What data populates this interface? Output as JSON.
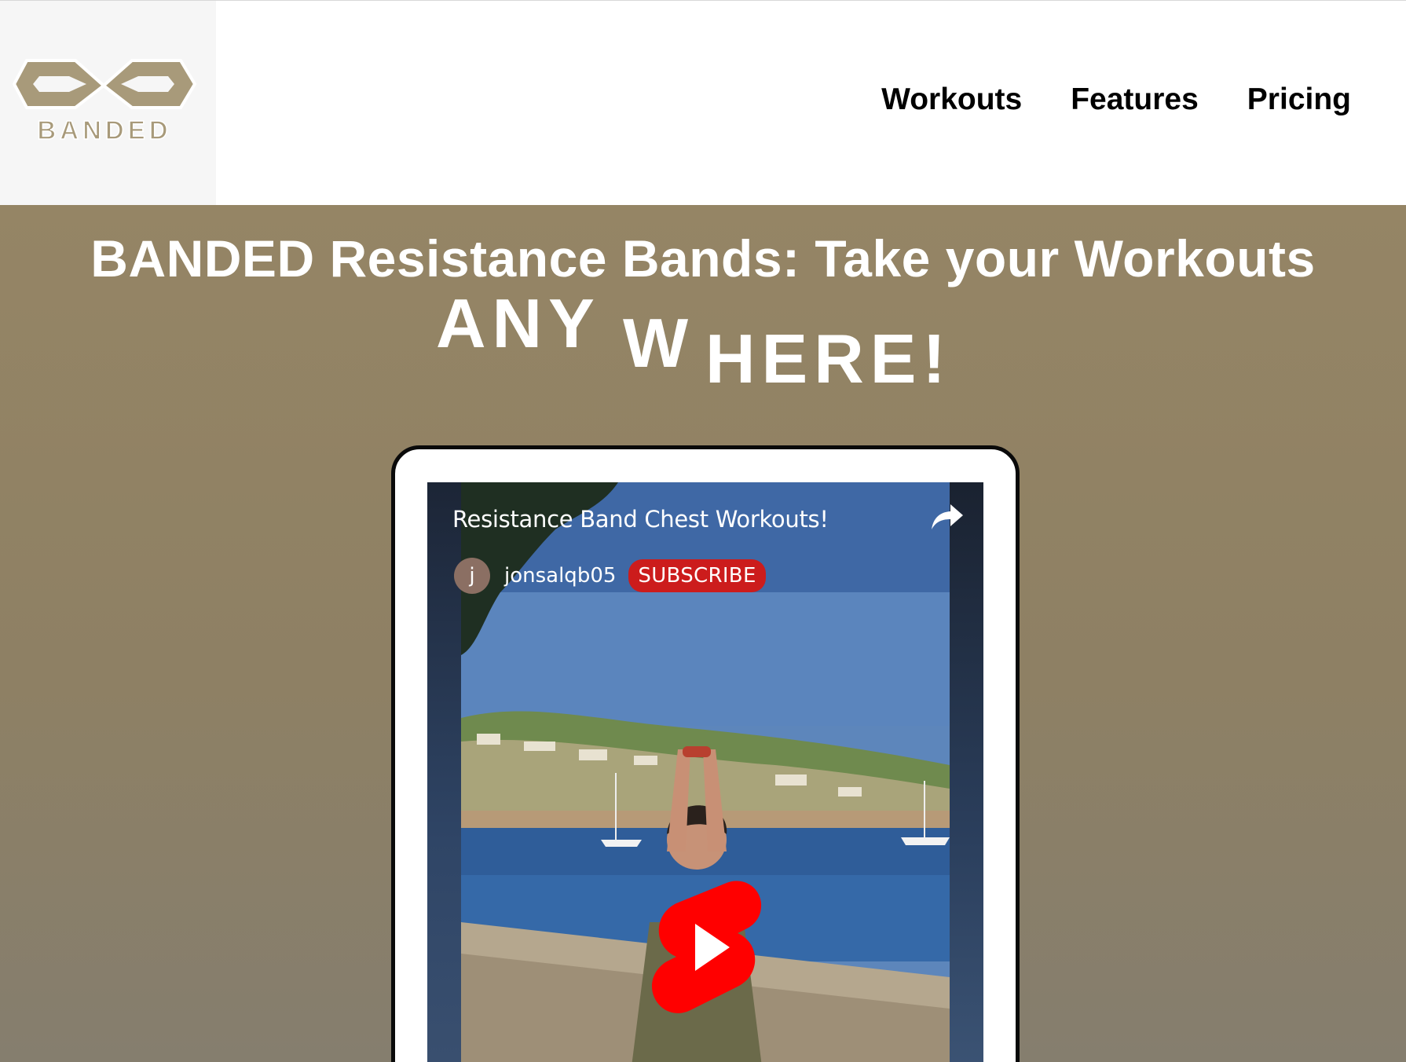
{
  "header": {
    "logo_text": "BANDED",
    "nav": [
      {
        "label": "Workouts"
      },
      {
        "label": "Features"
      },
      {
        "label": "Pricing"
      }
    ]
  },
  "hero": {
    "title": "BANDED Resistance Bands: Take your Workouts",
    "anywhere_parts": [
      "ANY",
      "W",
      "HERE!"
    ],
    "background_color": "#8f8163"
  },
  "video": {
    "title": "Resistance Band Chest Workouts!",
    "channel_initial": "j",
    "channel_name": "jonsalqb05",
    "subscribe_label": "SUBSCRIBE",
    "play_icon": "youtube-shorts-play-icon",
    "share_icon": "share-arrow-icon",
    "subscribe_color": "#cc1c1c"
  }
}
